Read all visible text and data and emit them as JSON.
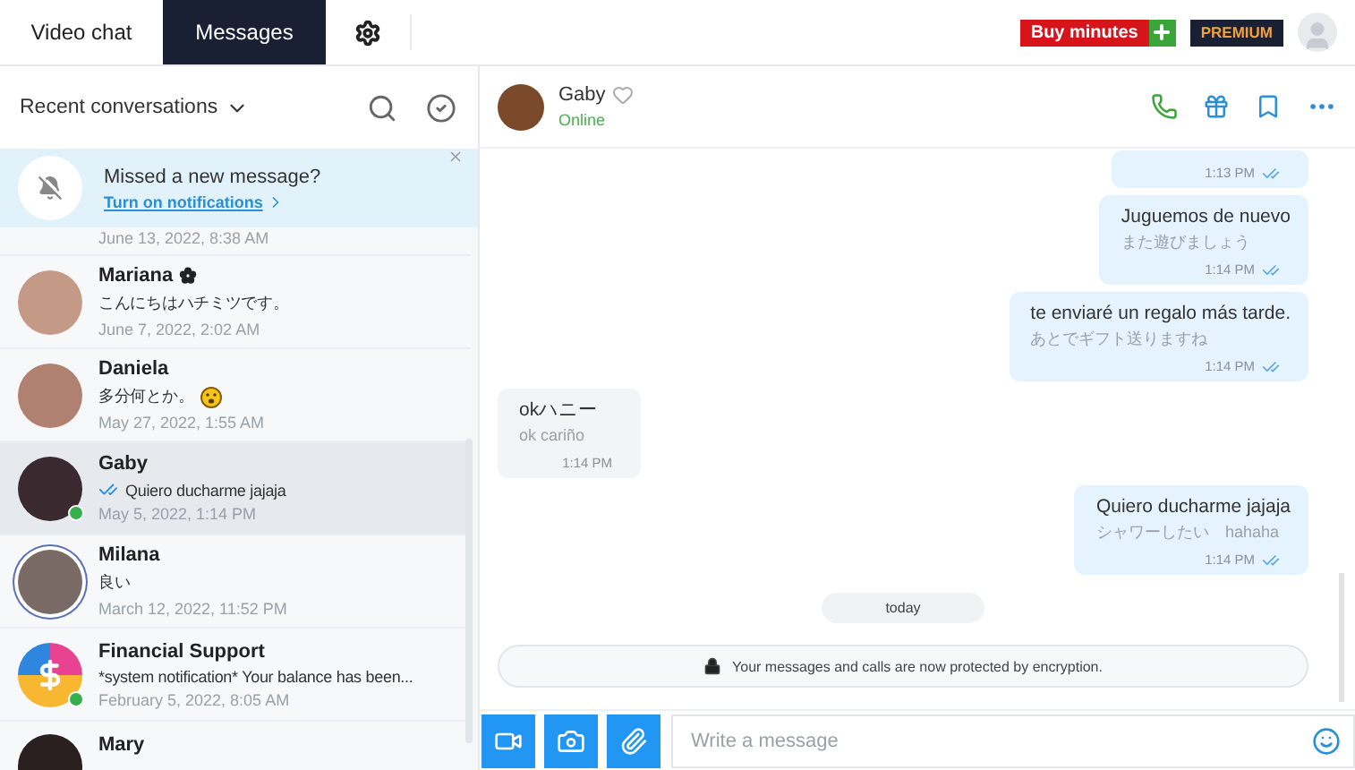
{
  "top_tabs": [
    {
      "label": "Video chat",
      "selected": false
    },
    {
      "label": "Messages",
      "selected": true
    }
  ],
  "top_actions": {
    "buy": "Buy minutes",
    "premium": "PREMIUM"
  },
  "sidebar": {
    "title": "Recent conversations",
    "banner": {
      "title": "Missed a new message?",
      "link": "Turn on notifications"
    },
    "conversations": [
      {
        "kind": "partial",
        "date": "June 13, 2022, 8:38 AM",
        "selected": false
      },
      {
        "kind": "photo",
        "name": "Mariana",
        "flower": true,
        "message": "こんにちはハチミツです。",
        "date": "June 7, 2022, 2:02 AM",
        "selected": false,
        "online": false
      },
      {
        "kind": "photo",
        "name": "Daniela",
        "message": "多分何とか。",
        "emoji": true,
        "date": "May 27, 2022, 1:55 AM",
        "selected": false,
        "online": false
      },
      {
        "kind": "photo",
        "name": "Gaby",
        "message": "Quiero ducharme jajaja",
        "read": true,
        "date": "May 5, 2022, 1:14 PM",
        "selected": true,
        "online": true
      },
      {
        "kind": "photo",
        "name": "Milana",
        "message": "良い",
        "date": "March 12, 2022, 11:52 PM",
        "selected": false,
        "online": false,
        "ring": true
      },
      {
        "kind": "logo",
        "name": "Financial Support",
        "message": "*system notification* Your balance has been...",
        "date": "February 5, 2022, 8:05 AM",
        "selected": false,
        "online": true
      },
      {
        "kind": "photo",
        "name": "Mary",
        "selected": false,
        "online": false
      }
    ]
  },
  "chat": {
    "name": "Gaby",
    "status": "Online",
    "favorite": false,
    "messages": [
      {
        "kind": "sent",
        "time": "1:13 PM",
        "read": true
      },
      {
        "kind": "sent",
        "text": "Juguemos de nuevo",
        "translation": "また遊びましょう",
        "time": "1:14 PM",
        "read": true
      },
      {
        "kind": "sent",
        "text": "te enviaré un regalo más tarde.",
        "translation": "あとでギフト送りますね",
        "time": "1:14 PM",
        "read": true
      },
      {
        "kind": "received",
        "text": "okハニー",
        "translation": "ok cariño",
        "time": "1:14 PM"
      },
      {
        "kind": "sent",
        "text": "Quiero ducharme jajaja",
        "translation": "シャワーしたい　hahaha",
        "time": "1:14 PM",
        "read": true
      }
    ],
    "day": "today",
    "notice": "Your messages and calls are now protected by encryption.",
    "composer": {
      "placeholder": "Write a message"
    }
  }
}
